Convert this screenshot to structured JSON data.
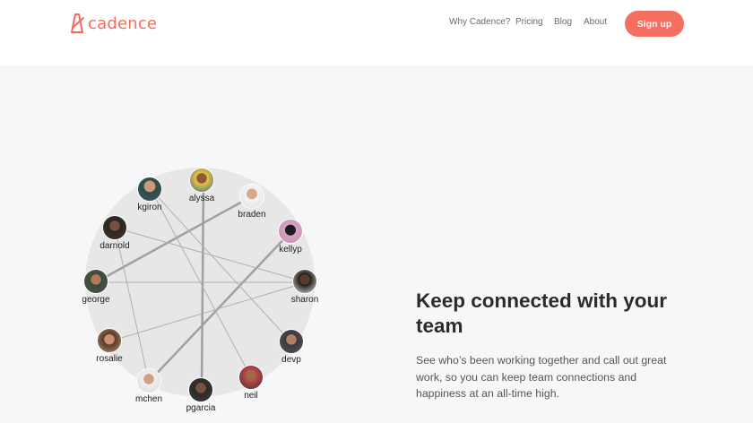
{
  "brand": {
    "name": "cadence",
    "color": "#f56b5b"
  },
  "nav": {
    "items": [
      {
        "label": "Why Cadence?"
      },
      {
        "label": "Pricing"
      },
      {
        "label": "Blog"
      },
      {
        "label": "About"
      }
    ],
    "signup_label": "Sign up"
  },
  "hero": {
    "headline": "Keep connected with your team",
    "subtext": "See who’s been working together and call out great work, so you can keep team connections and happiness at an all-time high."
  },
  "team": {
    "members": [
      {
        "username": "kgiron"
      },
      {
        "username": "alyssa"
      },
      {
        "username": "braden"
      },
      {
        "username": "kellyp"
      },
      {
        "username": "darnold"
      },
      {
        "username": "george"
      },
      {
        "username": "sharon"
      },
      {
        "username": "rosalie"
      },
      {
        "username": "devp"
      },
      {
        "username": "mchen"
      },
      {
        "username": "neil"
      },
      {
        "username": "pgarcia"
      }
    ]
  },
  "colors": {
    "accent": "#f56f61",
    "hero_bg": "#f7f7f9",
    "edge": "#a0a0a0",
    "circle_bg": "#e6e6e6"
  }
}
